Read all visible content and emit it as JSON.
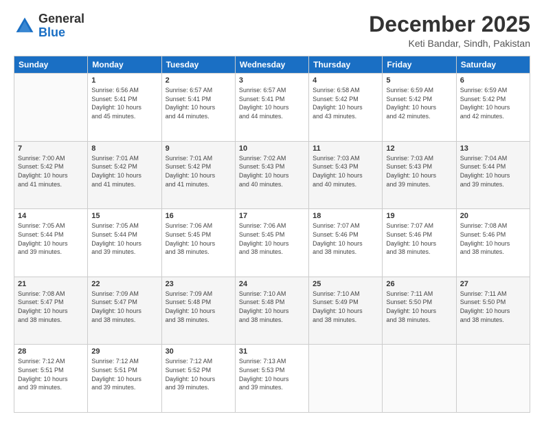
{
  "header": {
    "logo_general": "General",
    "logo_blue": "Blue",
    "month_title": "December 2025",
    "location": "Keti Bandar, Sindh, Pakistan"
  },
  "weekdays": [
    "Sunday",
    "Monday",
    "Tuesday",
    "Wednesday",
    "Thursday",
    "Friday",
    "Saturday"
  ],
  "weeks": [
    [
      {
        "day": "",
        "sunrise": "",
        "sunset": "",
        "daylight": ""
      },
      {
        "day": "1",
        "sunrise": "Sunrise: 6:56 AM",
        "sunset": "Sunset: 5:41 PM",
        "daylight": "Daylight: 10 hours and 45 minutes."
      },
      {
        "day": "2",
        "sunrise": "Sunrise: 6:57 AM",
        "sunset": "Sunset: 5:41 PM",
        "daylight": "Daylight: 10 hours and 44 minutes."
      },
      {
        "day": "3",
        "sunrise": "Sunrise: 6:57 AM",
        "sunset": "Sunset: 5:41 PM",
        "daylight": "Daylight: 10 hours and 44 minutes."
      },
      {
        "day": "4",
        "sunrise": "Sunrise: 6:58 AM",
        "sunset": "Sunset: 5:42 PM",
        "daylight": "Daylight: 10 hours and 43 minutes."
      },
      {
        "day": "5",
        "sunrise": "Sunrise: 6:59 AM",
        "sunset": "Sunset: 5:42 PM",
        "daylight": "Daylight: 10 hours and 42 minutes."
      },
      {
        "day": "6",
        "sunrise": "Sunrise: 6:59 AM",
        "sunset": "Sunset: 5:42 PM",
        "daylight": "Daylight: 10 hours and 42 minutes."
      }
    ],
    [
      {
        "day": "7",
        "sunrise": "Sunrise: 7:00 AM",
        "sunset": "Sunset: 5:42 PM",
        "daylight": "Daylight: 10 hours and 41 minutes."
      },
      {
        "day": "8",
        "sunrise": "Sunrise: 7:01 AM",
        "sunset": "Sunset: 5:42 PM",
        "daylight": "Daylight: 10 hours and 41 minutes."
      },
      {
        "day": "9",
        "sunrise": "Sunrise: 7:01 AM",
        "sunset": "Sunset: 5:42 PM",
        "daylight": "Daylight: 10 hours and 41 minutes."
      },
      {
        "day": "10",
        "sunrise": "Sunrise: 7:02 AM",
        "sunset": "Sunset: 5:43 PM",
        "daylight": "Daylight: 10 hours and 40 minutes."
      },
      {
        "day": "11",
        "sunrise": "Sunrise: 7:03 AM",
        "sunset": "Sunset: 5:43 PM",
        "daylight": "Daylight: 10 hours and 40 minutes."
      },
      {
        "day": "12",
        "sunrise": "Sunrise: 7:03 AM",
        "sunset": "Sunset: 5:43 PM",
        "daylight": "Daylight: 10 hours and 39 minutes."
      },
      {
        "day": "13",
        "sunrise": "Sunrise: 7:04 AM",
        "sunset": "Sunset: 5:44 PM",
        "daylight": "Daylight: 10 hours and 39 minutes."
      }
    ],
    [
      {
        "day": "14",
        "sunrise": "Sunrise: 7:05 AM",
        "sunset": "Sunset: 5:44 PM",
        "daylight": "Daylight: 10 hours and 39 minutes."
      },
      {
        "day": "15",
        "sunrise": "Sunrise: 7:05 AM",
        "sunset": "Sunset: 5:44 PM",
        "daylight": "Daylight: 10 hours and 39 minutes."
      },
      {
        "day": "16",
        "sunrise": "Sunrise: 7:06 AM",
        "sunset": "Sunset: 5:45 PM",
        "daylight": "Daylight: 10 hours and 38 minutes."
      },
      {
        "day": "17",
        "sunrise": "Sunrise: 7:06 AM",
        "sunset": "Sunset: 5:45 PM",
        "daylight": "Daylight: 10 hours and 38 minutes."
      },
      {
        "day": "18",
        "sunrise": "Sunrise: 7:07 AM",
        "sunset": "Sunset: 5:46 PM",
        "daylight": "Daylight: 10 hours and 38 minutes."
      },
      {
        "day": "19",
        "sunrise": "Sunrise: 7:07 AM",
        "sunset": "Sunset: 5:46 PM",
        "daylight": "Daylight: 10 hours and 38 minutes."
      },
      {
        "day": "20",
        "sunrise": "Sunrise: 7:08 AM",
        "sunset": "Sunset: 5:46 PM",
        "daylight": "Daylight: 10 hours and 38 minutes."
      }
    ],
    [
      {
        "day": "21",
        "sunrise": "Sunrise: 7:08 AM",
        "sunset": "Sunset: 5:47 PM",
        "daylight": "Daylight: 10 hours and 38 minutes."
      },
      {
        "day": "22",
        "sunrise": "Sunrise: 7:09 AM",
        "sunset": "Sunset: 5:47 PM",
        "daylight": "Daylight: 10 hours and 38 minutes."
      },
      {
        "day": "23",
        "sunrise": "Sunrise: 7:09 AM",
        "sunset": "Sunset: 5:48 PM",
        "daylight": "Daylight: 10 hours and 38 minutes."
      },
      {
        "day": "24",
        "sunrise": "Sunrise: 7:10 AM",
        "sunset": "Sunset: 5:48 PM",
        "daylight": "Daylight: 10 hours and 38 minutes."
      },
      {
        "day": "25",
        "sunrise": "Sunrise: 7:10 AM",
        "sunset": "Sunset: 5:49 PM",
        "daylight": "Daylight: 10 hours and 38 minutes."
      },
      {
        "day": "26",
        "sunrise": "Sunrise: 7:11 AM",
        "sunset": "Sunset: 5:50 PM",
        "daylight": "Daylight: 10 hours and 38 minutes."
      },
      {
        "day": "27",
        "sunrise": "Sunrise: 7:11 AM",
        "sunset": "Sunset: 5:50 PM",
        "daylight": "Daylight: 10 hours and 38 minutes."
      }
    ],
    [
      {
        "day": "28",
        "sunrise": "Sunrise: 7:12 AM",
        "sunset": "Sunset: 5:51 PM",
        "daylight": "Daylight: 10 hours and 39 minutes."
      },
      {
        "day": "29",
        "sunrise": "Sunrise: 7:12 AM",
        "sunset": "Sunset: 5:51 PM",
        "daylight": "Daylight: 10 hours and 39 minutes."
      },
      {
        "day": "30",
        "sunrise": "Sunrise: 7:12 AM",
        "sunset": "Sunset: 5:52 PM",
        "daylight": "Daylight: 10 hours and 39 minutes."
      },
      {
        "day": "31",
        "sunrise": "Sunrise: 7:13 AM",
        "sunset": "Sunset: 5:53 PM",
        "daylight": "Daylight: 10 hours and 39 minutes."
      },
      {
        "day": "",
        "sunrise": "",
        "sunset": "",
        "daylight": ""
      },
      {
        "day": "",
        "sunrise": "",
        "sunset": "",
        "daylight": ""
      },
      {
        "day": "",
        "sunrise": "",
        "sunset": "",
        "daylight": ""
      }
    ]
  ]
}
